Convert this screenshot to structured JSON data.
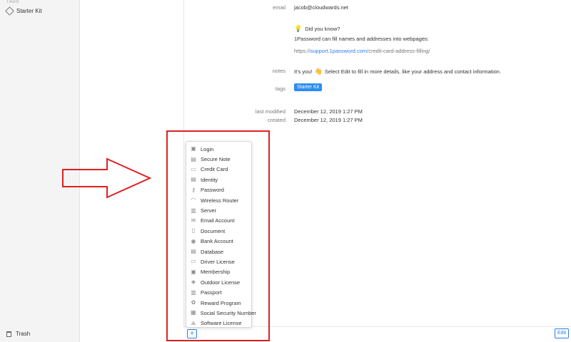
{
  "sidebar": {
    "tags_header": "TAGS",
    "tag_item": "Starter Kit",
    "trash": "Trash"
  },
  "details": {
    "email_label": "email",
    "email_value": "jacob@cloudwards.net",
    "did_you_know": "Did you know?",
    "fill_text": "1Password can fill names and addresses into webpages:",
    "link_prefix": "https://",
    "link_text": "support.1password.com",
    "link_suffix": "/credit-card-address-filling/",
    "notes_label": "notes",
    "notes_value_pre": "It's you!",
    "notes_value_post": "Select Edit to fill in more details, like your address and contact information.",
    "tags_label": "tags",
    "tag_badge": "Starter Kit",
    "last_modified_label": "last modified",
    "last_modified_value": "December 12, 2019 1:27 PM",
    "created_label": "created",
    "created_value": "December 12, 2019 1:27 PM"
  },
  "menu": {
    "items": [
      {
        "label": "Login",
        "icon": "login-icon",
        "glyph": "▣"
      },
      {
        "label": "Secure Note",
        "icon": "secure-note-icon",
        "glyph": "▤"
      },
      {
        "label": "Credit Card",
        "icon": "credit-card-icon",
        "glyph": "▭"
      },
      {
        "label": "Identity",
        "icon": "identity-icon",
        "glyph": "▤"
      },
      {
        "label": "Password",
        "icon": "password-icon",
        "glyph": "⚷"
      },
      {
        "label": "Wireless Router",
        "icon": "wireless-router-icon",
        "glyph": "◠"
      },
      {
        "label": "Server",
        "icon": "server-icon",
        "glyph": "▥"
      },
      {
        "label": "Email Account",
        "icon": "email-account-icon",
        "glyph": "✉"
      },
      {
        "label": "Document",
        "icon": "document-icon",
        "glyph": "▯"
      },
      {
        "label": "Bank Account",
        "icon": "bank-account-icon",
        "glyph": "◉"
      },
      {
        "label": "Database",
        "icon": "database-icon",
        "glyph": "▤"
      },
      {
        "label": "Driver License",
        "icon": "driver-license-icon",
        "glyph": "▭"
      },
      {
        "label": "Membership",
        "icon": "membership-icon",
        "glyph": "▣"
      },
      {
        "label": "Outdoor License",
        "icon": "outdoor-license-icon",
        "glyph": "◈"
      },
      {
        "label": "Passport",
        "icon": "passport-icon",
        "glyph": "▥"
      },
      {
        "label": "Reward Program",
        "icon": "reward-program-icon",
        "glyph": "✿"
      },
      {
        "label": "Social Security Number",
        "icon": "ssn-icon",
        "glyph": "▦"
      },
      {
        "label": "Software License",
        "icon": "software-license-icon",
        "glyph": "⟁"
      }
    ]
  },
  "toolbar": {
    "add_label": "+",
    "edit_label": "Edit"
  },
  "colors": {
    "accent": "#2b7de9",
    "highlight": "#e02020"
  }
}
